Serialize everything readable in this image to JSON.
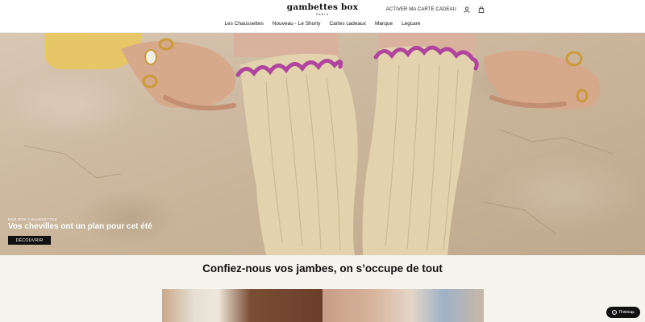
{
  "header": {
    "logo_main": "gambettes box",
    "logo_sub": "PARIS",
    "activate_label": "ACTIVER MA CARTE CADEAU",
    "account_icon": "user-icon",
    "cart_icon": "bag-icon"
  },
  "nav": {
    "items": [
      {
        "label": "Les Chaussettes"
      },
      {
        "label": "Nouveau - Le Shorty"
      },
      {
        "label": "Cartes cadeaux"
      },
      {
        "label": "Marque"
      },
      {
        "label": "Legcare"
      }
    ]
  },
  "hero": {
    "eyebrow": "NOS BOX CHAUSSETTES",
    "title": "Vos chevilles ont un plan pour cet été",
    "cta_label": "DÉCOUVRIR"
  },
  "section": {
    "title": "Confiez-nous vos jambes, on s’occupe de tout"
  },
  "help": {
    "label": "Помощь",
    "icon": "question-icon"
  },
  "colors": {
    "accent": "#111111",
    "sock_trim": "#b0459d",
    "sock": "#e3d4b0"
  }
}
